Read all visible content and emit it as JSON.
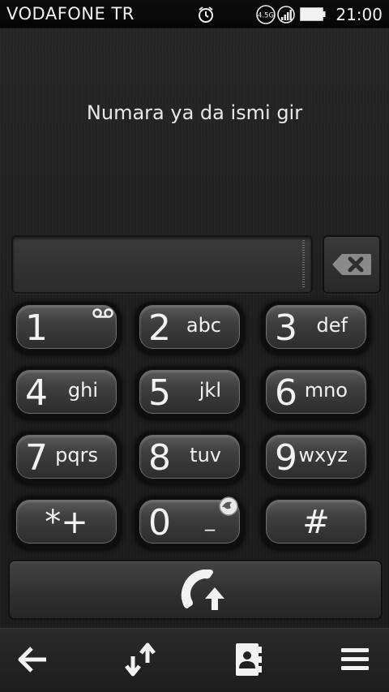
{
  "status_bar": {
    "carrier": "VODAFONE TR",
    "time": "21:00",
    "network_badge": "4.5G",
    "icons": [
      "alarm-icon",
      "network-4-5g-icon",
      "signal-icon",
      "battery-icon"
    ]
  },
  "dialer": {
    "prompt": "Numara ya da ismi gir",
    "entry_value": "",
    "keys": [
      {
        "digit": "1",
        "letters": "",
        "badge": "voicemail-icon"
      },
      {
        "digit": "2",
        "letters": "abc"
      },
      {
        "digit": "3",
        "letters": "def"
      },
      {
        "digit": "4",
        "letters": "ghi"
      },
      {
        "digit": "5",
        "letters": "jkl"
      },
      {
        "digit": "6",
        "letters": "mno"
      },
      {
        "digit": "7",
        "letters": "pqrs"
      },
      {
        "digit": "8",
        "letters": "tuv"
      },
      {
        "digit": "9",
        "letters": "wxyz"
      },
      {
        "digit": "*+",
        "letters": ""
      },
      {
        "digit": "0",
        "letters": "_",
        "badge": "globe-icon"
      },
      {
        "digit": "#",
        "letters": ""
      }
    ]
  },
  "bottom_bar": {
    "buttons": [
      "back-arrow-icon",
      "sort-arrows-icon",
      "contacts-book-icon",
      "menu-icon"
    ]
  },
  "colors": {
    "background": "#1c1c1c",
    "key_face": "#3e3e3e",
    "text": "#f2f2f2"
  }
}
